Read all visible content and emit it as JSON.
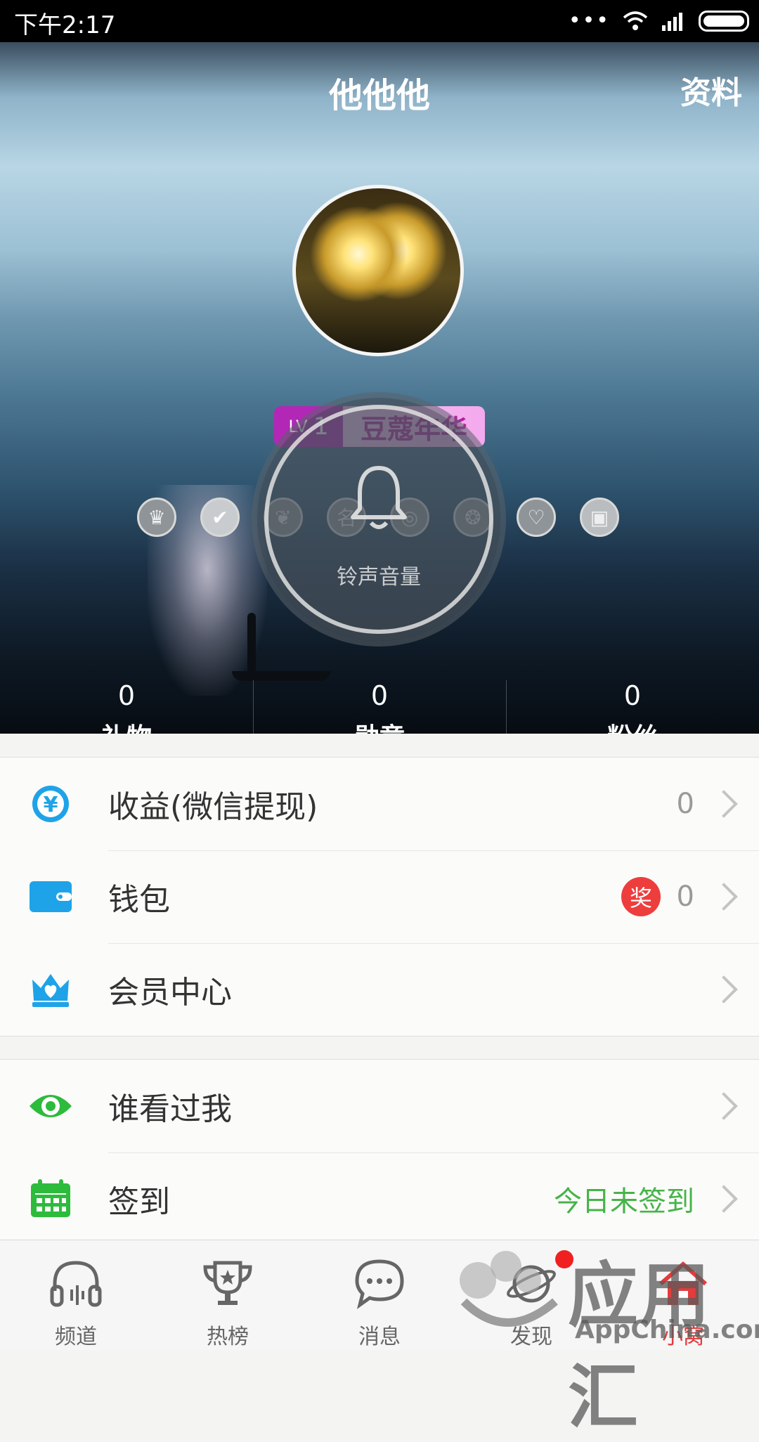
{
  "status_bar": {
    "time": "下午2:17",
    "dots": "•••"
  },
  "header": {
    "title": "他他他",
    "profile_link": "资料",
    "level": {
      "lv_prefix": "LV.",
      "lv_number": "1",
      "rank_name": "豆蔻年华"
    },
    "badges": [
      {
        "icon": "crown-badge-icon"
      },
      {
        "icon": "check-badge-icon"
      },
      {
        "icon": "leaf-badge-icon"
      },
      {
        "icon": "name-badge-icon"
      },
      {
        "icon": "coin-badge-icon"
      },
      {
        "icon": "flame-badge-icon"
      },
      {
        "icon": "hearts-badge-icon"
      },
      {
        "icon": "gift-badge-icon"
      }
    ],
    "stats": [
      {
        "value": "0",
        "label": "礼物"
      },
      {
        "value": "0",
        "label": "勋章"
      },
      {
        "value": "0",
        "label": "粉丝"
      }
    ]
  },
  "volume_overlay": {
    "label": "铃声音量",
    "icon": "bell-icon"
  },
  "menu_group_1": [
    {
      "label": "收益(微信提现)",
      "value": "0",
      "icon": "yuan-icon"
    },
    {
      "label": "钱包",
      "value": "0",
      "prize": "奖",
      "icon": "wallet-icon"
    },
    {
      "label": "会员中心",
      "value": "",
      "icon": "crown-heart-icon"
    }
  ],
  "menu_group_2": [
    {
      "label": "谁看过我",
      "value": "",
      "icon": "eye-icon"
    },
    {
      "label": "签到",
      "value": "今日未签到",
      "icon": "calendar-icon"
    }
  ],
  "tabs": [
    {
      "label": "频道",
      "icon": "headphones-icon"
    },
    {
      "label": "热榜",
      "icon": "trophy-icon"
    },
    {
      "label": "消息",
      "icon": "chat-bubble-icon"
    },
    {
      "label": "发现",
      "icon": "planet-icon"
    },
    {
      "label": "小窝",
      "icon": "home-icon",
      "active": true
    }
  ],
  "watermark": {
    "zh": "应用汇",
    "en": "AppChina.com"
  },
  "colors": {
    "accent_blue": "#1fa3e8",
    "accent_green": "#47b34a",
    "level_purple": "#b327b6",
    "alert_red": "#ee3d3d"
  }
}
